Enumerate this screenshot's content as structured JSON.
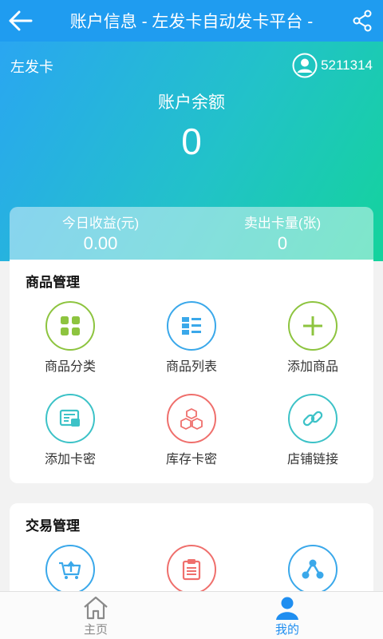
{
  "header": {
    "title": "账户信息 - 左发卡自动发卡平台 -",
    "back_icon": "arrow-left-icon",
    "share_icon": "share-icon",
    "bg_color": "#1f9cf0"
  },
  "account": {
    "brand": "左发卡",
    "user_id": "5211314",
    "balance_label": "账户余额",
    "balance_value": "0"
  },
  "stats": [
    {
      "label": "今日收益(元)",
      "value": "0.00"
    },
    {
      "label": "卖出卡量(张)",
      "value": "0"
    }
  ],
  "product_section": {
    "title": "商品管理",
    "items": [
      {
        "label": "商品分类",
        "icon": "grid-icon",
        "color": "#8dc43f"
      },
      {
        "label": "商品列表",
        "icon": "list-icon",
        "color": "#3aa8ea"
      },
      {
        "label": "添加商品",
        "icon": "plus-icon",
        "color": "#8dc43f"
      },
      {
        "label": "添加卡密",
        "icon": "card-icon",
        "color": "#3cc2c7"
      },
      {
        "label": "库存卡密",
        "icon": "boxes-icon",
        "color": "#ef6f6c"
      },
      {
        "label": "店铺链接",
        "icon": "link-icon",
        "color": "#3cc2c7"
      }
    ]
  },
  "trade_section": {
    "title": "交易管理",
    "items": [
      {
        "label": "",
        "icon": "cart-upload-icon",
        "color": "#3aa8ea"
      },
      {
        "label": "",
        "icon": "clipboard-icon",
        "color": "#ef6f6c"
      },
      {
        "label": "",
        "icon": "share-nodes-icon",
        "color": "#3aa8ea"
      }
    ]
  },
  "tabs": [
    {
      "label": "主页",
      "icon": "home-icon",
      "active": false,
      "color": "#8a8a8a"
    },
    {
      "label": "我的",
      "icon": "user-icon",
      "active": true,
      "color": "#1f8ef0"
    }
  ]
}
